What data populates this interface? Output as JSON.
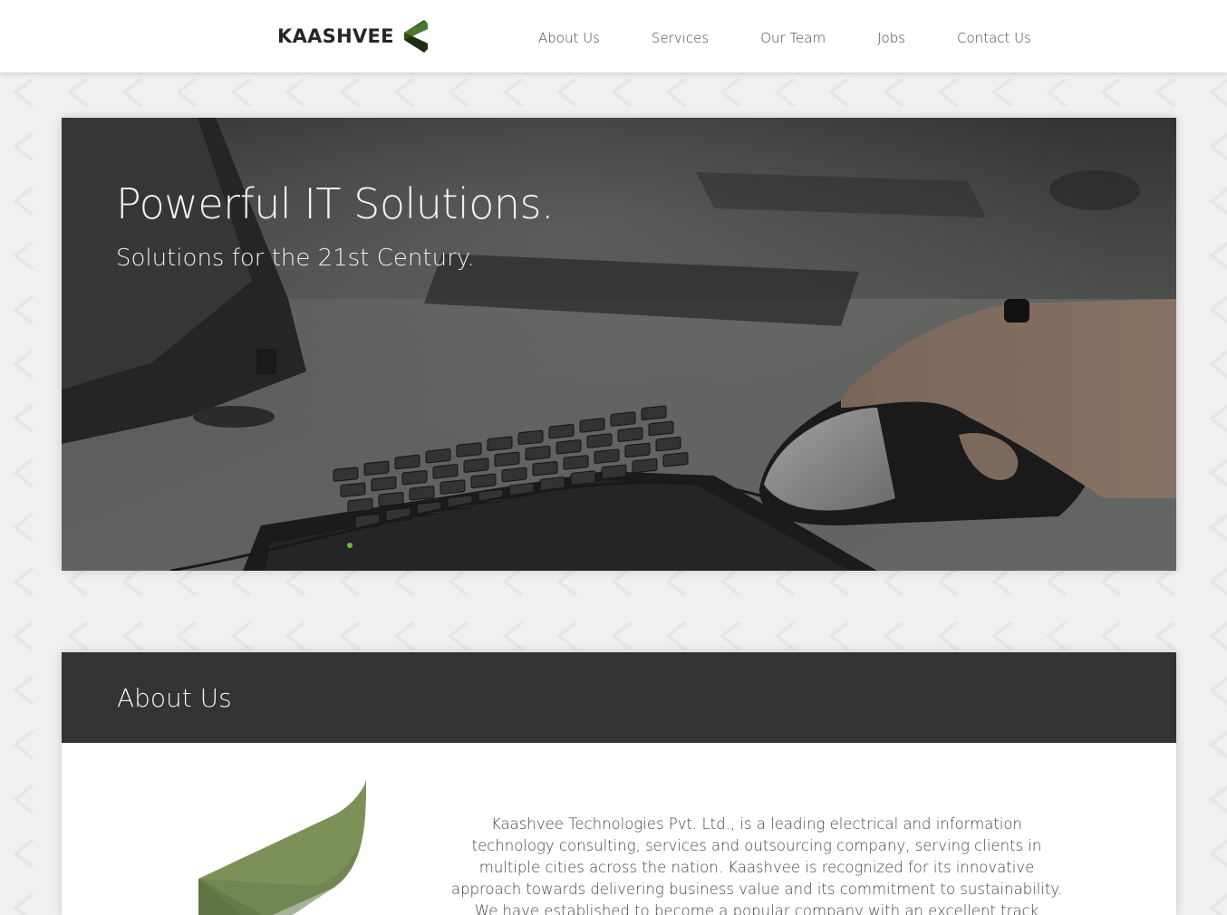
{
  "brand": {
    "name": "KAASHVEE",
    "accent_dark": "#2f4a1c",
    "accent_mid": "#4c7a2c",
    "accent_light": "#7b9158"
  },
  "nav": {
    "items": [
      {
        "label": "About Us"
      },
      {
        "label": "Services"
      },
      {
        "label": "Our Team"
      },
      {
        "label": "Jobs"
      },
      {
        "label": "Contact Us"
      }
    ]
  },
  "hero": {
    "title": "Powerful IT Solutions.",
    "subtitle": "Solutions for the 21st Century."
  },
  "about": {
    "title": "About Us",
    "text": "Kaashvee Technologies Pvt. Ltd., is a leading electrical and information technology consulting, services and outsourcing company, serving clients in multiple cities across the nation. Kaashvee is recognized for its innovative approach towards delivering business value and its commitment to sustainability. We have established to become a popular company with an excellent track"
  },
  "colors": {
    "header_bg": "#ffffff",
    "page_bg": "#f0f0f0",
    "section_head_bg": "#333333"
  }
}
